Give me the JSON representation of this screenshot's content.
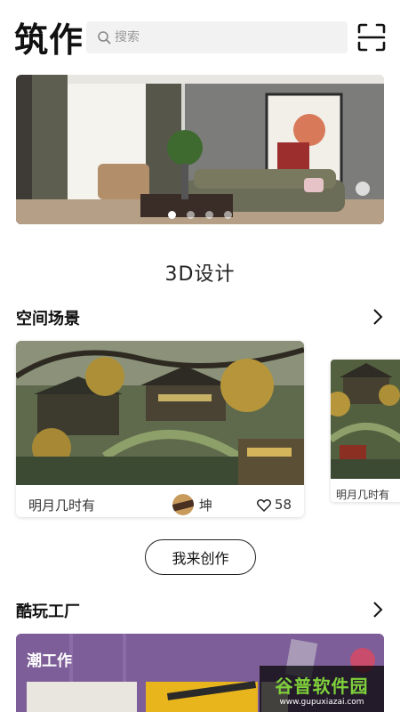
{
  "header": {
    "logo": "筑作",
    "search_placeholder": "搜索",
    "scan_icon": "scan-icon"
  },
  "banner": {
    "dot_count": 4,
    "active_dot": 0
  },
  "design_section": {
    "title": "3D设计"
  },
  "space_scenes": {
    "title": "空间场景",
    "cards": [
      {
        "name": "明月几时有",
        "author": "坤",
        "likes": "58"
      },
      {
        "name": "明月几时有"
      }
    ]
  },
  "create_button": {
    "label": "我来创作"
  },
  "fun_factory": {
    "title": "酷玩工厂",
    "banner_title": "潮工作"
  },
  "watermark": {
    "name": "谷普软件园",
    "url": "www.gupuxiazai.com"
  },
  "colors": {
    "factory_bg": "#7d5e98",
    "watermark_green": "#7fd13b"
  }
}
